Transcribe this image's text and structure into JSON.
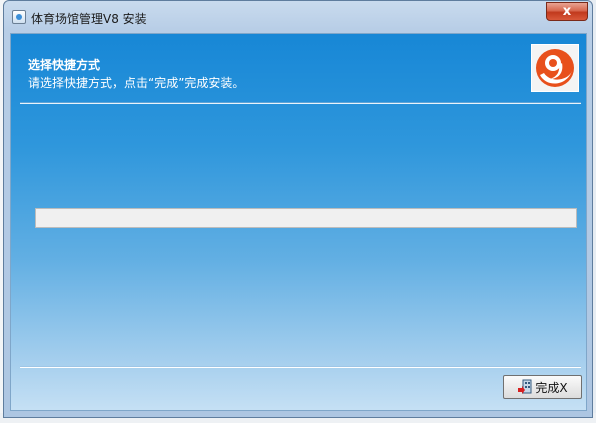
{
  "window": {
    "title": "体育场馆管理V8 安装",
    "close_label": "x"
  },
  "header": {
    "title": "选择快捷方式",
    "subtitle": "请选择快捷方式，点击“完成”完成安装。"
  },
  "progress": {
    "value": 0
  },
  "footer": {
    "finish_label": "完成X"
  },
  "colors": {
    "client_gradient_top": "#1787d6",
    "client_gradient_bottom": "#c5e0f4",
    "close_button": "#c1391d",
    "logo_orange": "#e8501c"
  },
  "icons": {
    "app": "installer-icon",
    "logo": "swirl-logo-icon",
    "finish": "finish-flag-icon"
  }
}
